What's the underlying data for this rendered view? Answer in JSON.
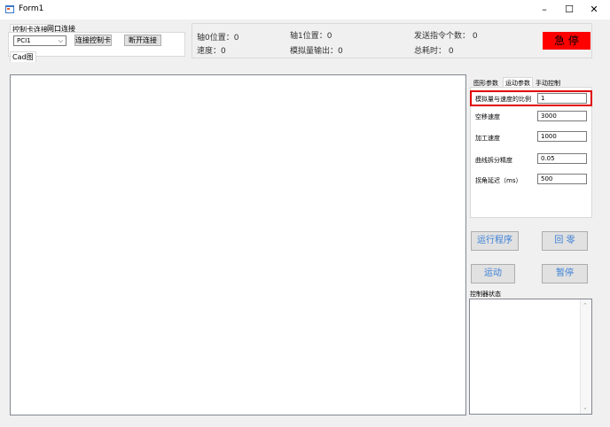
{
  "window": {
    "title": "Form1",
    "min_glyph": "–",
    "max_glyph": "☐",
    "close_glyph": "✕"
  },
  "connect": {
    "tabs": [
      "控制卡连接",
      "网口连接"
    ],
    "card_value": "PCI1",
    "connect_button": "连接控制卡",
    "disconnect_button": "断开连接"
  },
  "canvas_tab": "Cad图",
  "status": {
    "axis0_pos": "轴0位置：0",
    "speed": "速度：0",
    "axis1_pos": "轴1位置：0",
    "analog_out": "模拟量输出：0",
    "cmd_count": "发送指令个数：  0",
    "total_time": "总耗时：  0"
  },
  "estop_label": "急 停",
  "right_tabs": [
    "图形参数",
    "运动参数",
    "手动控制"
  ],
  "params": [
    {
      "label": "模拟量与速度的比例",
      "value": "1"
    },
    {
      "label": "空移速度",
      "value": "3000"
    },
    {
      "label": "加工速度",
      "value": "1000"
    },
    {
      "label": "曲线拆分精度",
      "value": "0.05"
    },
    {
      "label": "拐角延迟（ms）",
      "value": "500"
    }
  ],
  "buttons": {
    "run": "运行程序",
    "home": "回  零",
    "motion": "运动",
    "pause": "暂停"
  },
  "controller_status_label": "控制器状态",
  "colors": {
    "estop_bg": "#ff0000",
    "highlight": "#e00000",
    "button_text": "#3a7fd6"
  }
}
